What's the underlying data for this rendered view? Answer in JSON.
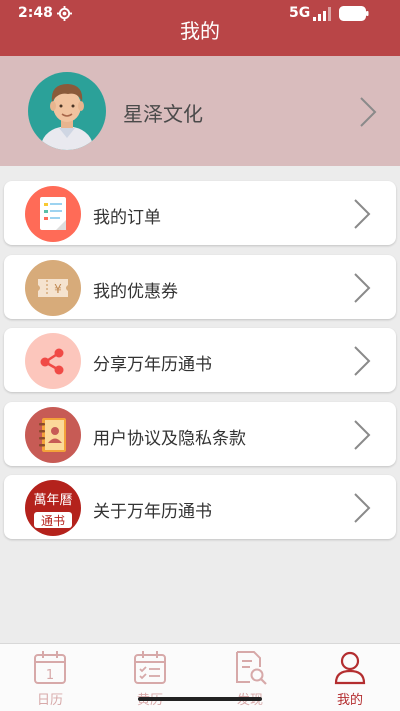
{
  "status_bar": {
    "time": "2:48",
    "network": "5G"
  },
  "header": {
    "title": "我的"
  },
  "profile": {
    "name": "星泽文化"
  },
  "menu": {
    "items": [
      {
        "label": "我的订单"
      },
      {
        "label": "我的优惠券",
        "icon_char": "¥"
      },
      {
        "label": "分享万年历通书"
      },
      {
        "label": "用户协议及隐私条款"
      },
      {
        "label": "关于万年历通书",
        "logo_top": "萬年曆",
        "logo_bottom": "通书"
      }
    ]
  },
  "tabbar": {
    "tabs": [
      {
        "label": "日历",
        "icon_text": "1"
      },
      {
        "label": "黄历"
      },
      {
        "label": "发现"
      },
      {
        "label": "我的",
        "active": true
      }
    ]
  },
  "colors": {
    "header": "#b94547",
    "profile_bg": "#d9bcbd",
    "accent": "#b32d2f",
    "tab_inactive": "#d7a9a9"
  }
}
